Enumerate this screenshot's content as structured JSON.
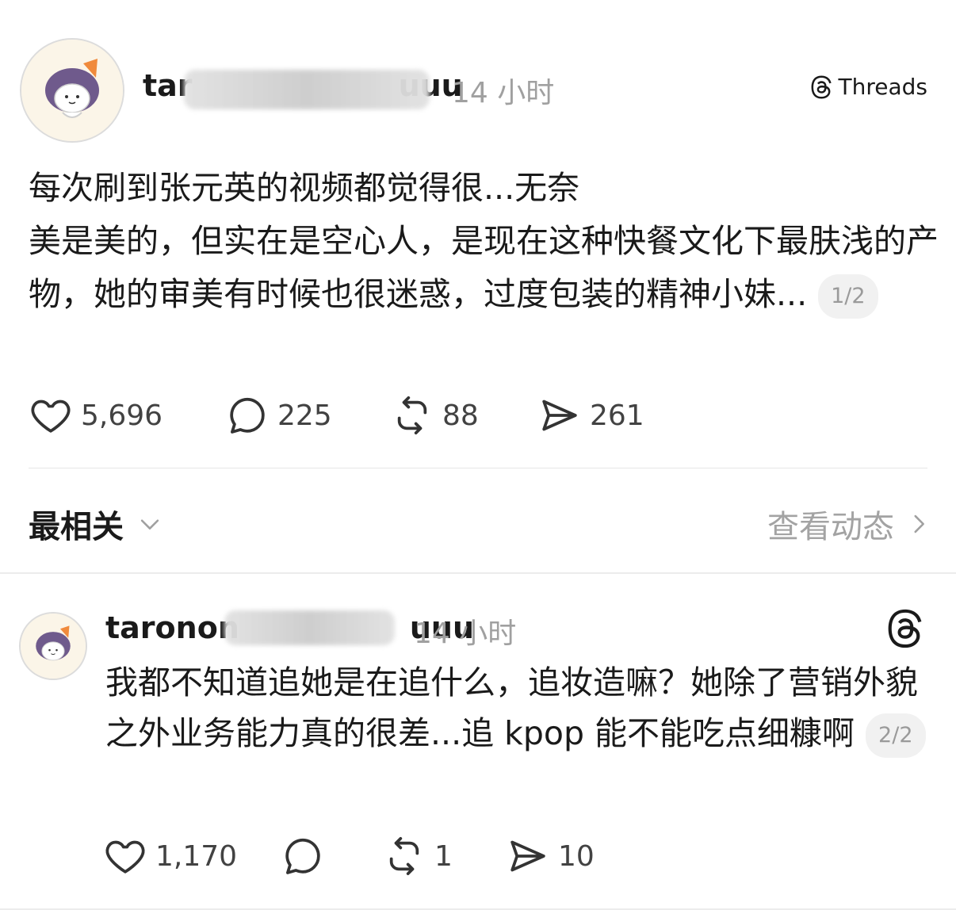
{
  "post": {
    "username": "tar",
    "username_end": "uuu",
    "time": "14 小时",
    "threads_label": "Threads",
    "text_lines": [
      "每次刷到张元英的视频都觉得很...无奈",
      "美是美的，但实在是空心人，是现在这种快餐文化下最肤浅的产物，她的审美有时候也很迷惑，过度包装的精神小妹..."
    ],
    "page": "1/2",
    "likes": "5,696",
    "replies": "225",
    "reposts": "88",
    "shares": "261"
  },
  "sort": {
    "label": "最相关",
    "activity_label": "查看动态"
  },
  "reply": {
    "username": "taronon",
    "username_end": "uuu",
    "time": "14 小时",
    "text": "我都不知道追她是在追什么，追妆造嘛？她除了营销外貌之外业务能力真的很差...追 kpop 能不能吃点细糠啊",
    "page": "2/2",
    "likes": "1,170",
    "reposts": "1",
    "shares": "10"
  },
  "icons": {
    "threads": "threads-icon",
    "like": "heart-icon",
    "reply": "comment-icon",
    "repost": "repost-icon",
    "share": "send-icon",
    "sort": "chevron-down-icon",
    "activity": "chevron-right-icon"
  }
}
